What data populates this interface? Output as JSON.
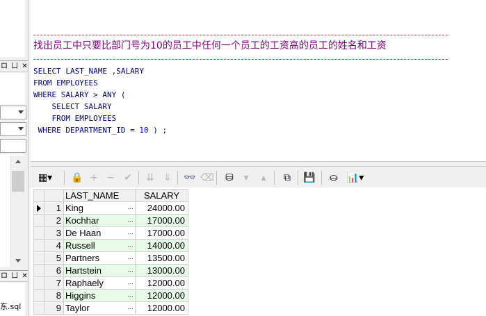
{
  "left_panel": {
    "bar1_text": "ロ ㄩ ✕",
    "bar2_text": "ロ ㄩ ✕",
    "file_label": "东.sql"
  },
  "editor": {
    "comment": "找出员工中只要比部门号为10的员工中任何一个员工的工资高的员工的姓名和工资",
    "code_lines": [
      {
        "parts": [
          {
            "t": "SELECT LAST_NAME ,SALARY",
            "k": "kw"
          }
        ]
      },
      {
        "parts": [
          {
            "t": "FROM EMPLOYEES",
            "k": "kw"
          }
        ]
      },
      {
        "parts": [
          {
            "t": "WHERE SALARY > ANY (",
            "k": "kw"
          }
        ]
      },
      {
        "parts": [
          {
            "t": "    SELECT SALARY",
            "k": "kw"
          }
        ]
      },
      {
        "parts": [
          {
            "t": "    FROM EMPLOYEES",
            "k": "kw"
          }
        ]
      },
      {
        "parts": [
          {
            "t": " WHERE DEPARTMENT_ID = ",
            "k": "kw"
          },
          {
            "t": "10",
            "k": "num"
          },
          {
            "t": " ) ;",
            "k": "kw"
          }
        ]
      }
    ],
    "comment_color": "#800080",
    "keyword_color": "#000080",
    "number_color": "#0000ff",
    "separator_color": "#e03030"
  },
  "toolbar": [
    {
      "icon": "grid-menu-icon",
      "glyph": "▦▾",
      "enabled": true
    },
    {
      "icon": "lock-icon",
      "glyph": "🔒",
      "enabled": true
    },
    {
      "icon": "add-icon",
      "glyph": "+",
      "enabled": false
    },
    {
      "icon": "remove-icon",
      "glyph": "−",
      "enabled": false
    },
    {
      "icon": "post-icon",
      "glyph": "✔",
      "enabled": false
    },
    {
      "icon": "next-page-icon",
      "glyph": "⇊",
      "enabled": false
    },
    {
      "icon": "last-page-icon",
      "glyph": "⇓",
      "enabled": false
    },
    {
      "icon": "find-icon",
      "glyph": "👓",
      "enabled": true
    },
    {
      "icon": "clear-icon",
      "glyph": "⌫",
      "enabled": false
    },
    {
      "icon": "query-by-example-icon",
      "glyph": "⛁",
      "enabled": true
    },
    {
      "icon": "previous-record-icon",
      "glyph": "▾",
      "enabled": false
    },
    {
      "icon": "next-record-icon",
      "glyph": "▴",
      "enabled": false
    },
    {
      "icon": "single-record-view-icon",
      "glyph": "⧉",
      "enabled": true
    },
    {
      "icon": "save-icon",
      "glyph": "💾",
      "enabled": true
    },
    {
      "icon": "export-icon",
      "glyph": "⛀",
      "enabled": true
    },
    {
      "icon": "chart-icon",
      "glyph": "📊▾",
      "enabled": true
    }
  ],
  "grid": {
    "columns": [
      "LAST_NAME",
      "SALARY"
    ],
    "current_row": 1,
    "rows": [
      {
        "n": "1",
        "name": "King",
        "salary": "24000.00"
      },
      {
        "n": "2",
        "name": "Kochhar",
        "salary": "17000.00"
      },
      {
        "n": "3",
        "name": "De Haan",
        "salary": "17000.00"
      },
      {
        "n": "4",
        "name": "Russell",
        "salary": "14000.00"
      },
      {
        "n": "5",
        "name": "Partners",
        "salary": "13500.00"
      },
      {
        "n": "6",
        "name": "Hartstein",
        "salary": "13000.00"
      },
      {
        "n": "7",
        "name": "Raphaely",
        "salary": "12000.00"
      },
      {
        "n": "8",
        "name": "Higgins",
        "salary": "12000.00"
      },
      {
        "n": "9",
        "name": "Taylor",
        "salary": "12000.00"
      }
    ],
    "alt_row_color": "#e8fbe8"
  }
}
